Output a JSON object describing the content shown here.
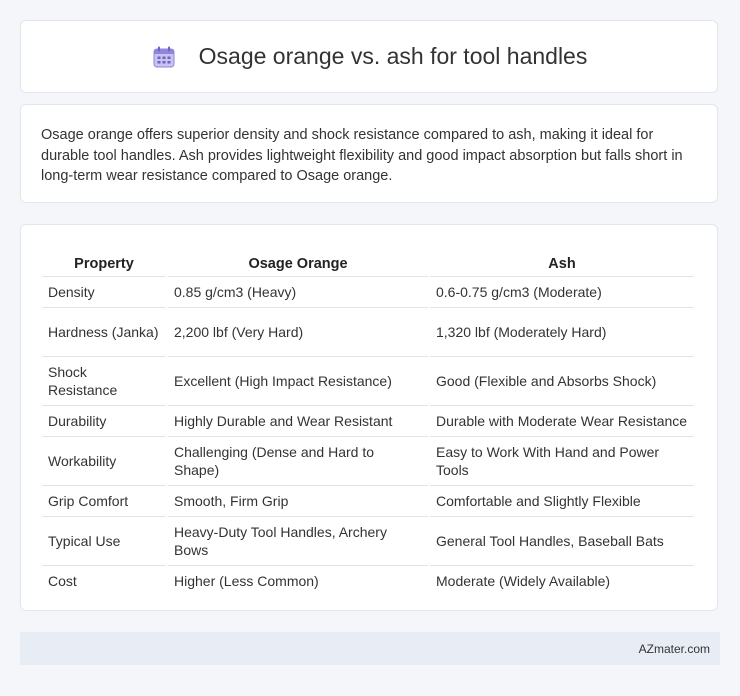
{
  "header": {
    "icon": "calendar-icon",
    "title": "Osage orange vs. ash for tool handles"
  },
  "summary": {
    "text": "Osage orange offers superior density and shock resistance compared to ash, making it ideal for durable tool handles. Ash provides lightweight flexibility and good impact absorption but falls short in long-term wear resistance compared to Osage orange."
  },
  "table": {
    "headers": [
      "Property",
      "Osage Orange",
      "Ash"
    ],
    "rows": [
      [
        "Density",
        "0.85 g/cm3 (Heavy)",
        "0.6-0.75 g/cm3 (Moderate)"
      ],
      [
        "Hardness (Janka)",
        "2,200 lbf (Very Hard)",
        "1,320 lbf (Moderately Hard)"
      ],
      [
        "Shock Resistance",
        "Excellent (High Impact Resistance)",
        "Good (Flexible and Absorbs Shock)"
      ],
      [
        "Durability",
        "Highly Durable and Wear Resistant",
        "Durable with Moderate Wear Resistance"
      ],
      [
        "Workability",
        "Challenging (Dense and Hard to Shape)",
        "Easy to Work With Hand and Power Tools"
      ],
      [
        "Grip Comfort",
        "Smooth, Firm Grip",
        "Comfortable and Slightly Flexible"
      ],
      [
        "Typical Use",
        "Heavy-Duty Tool Handles, Archery Bows",
        "General Tool Handles, Baseball Bats"
      ],
      [
        "Cost",
        "Higher (Less Common)",
        "Moderate (Widely Available)"
      ]
    ]
  },
  "footer": {
    "brand": "AZmater.com"
  }
}
